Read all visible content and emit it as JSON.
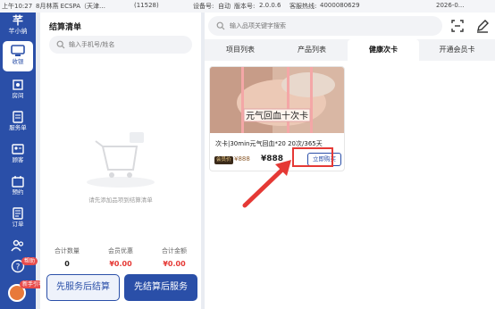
{
  "status_bar": {
    "time": "上午10:27",
    "shop": "8月林燕 ECSPA（天津…",
    "shop_id": "(11528)",
    "device_label": "设备号:",
    "device_value": "自动",
    "version_label": "版本号:",
    "version_value": "2.0.0.6",
    "phone_label": "客服热线:",
    "phone_value": "4000080629",
    "date": "2026-0..."
  },
  "sidebar": {
    "brand": "芊小纳",
    "items": [
      {
        "label": "收银",
        "icon": "monitor-icon"
      },
      {
        "label": "房间",
        "icon": "room-icon"
      },
      {
        "label": "服务单",
        "icon": "service-order-icon"
      },
      {
        "label": "顾客",
        "icon": "customer-icon"
      },
      {
        "label": "预约",
        "icon": "calendar-icon"
      },
      {
        "label": "订单",
        "icon": "order-icon"
      },
      {
        "label": "",
        "icon": "people-icon"
      }
    ],
    "help_tag": "帮助",
    "guide_tag": "新手引导"
  },
  "left_panel": {
    "title": "结算清单",
    "search_placeholder": "输入手机号/姓名",
    "empty_text": "请先添加品项到结算清单",
    "totals": [
      {
        "label": "合计数量",
        "value": "0"
      },
      {
        "label": "会员优惠",
        "value": "¥0.00"
      },
      {
        "label": "合计金额",
        "value": "¥0.00"
      }
    ],
    "btn_service_first": "先服务后结算",
    "btn_settle_first": "先结算后服务"
  },
  "right_panel": {
    "search_placeholder": "输入品项关键字搜索",
    "tabs": [
      {
        "label": "项目列表",
        "active": false
      },
      {
        "label": "产品列表",
        "active": false
      },
      {
        "label": "健康次卡",
        "active": true
      },
      {
        "label": "开通会员卡",
        "active": false
      }
    ],
    "card": {
      "image_caption": "元气回血十次卡",
      "name": "次卡|30min元气回血*20 20次/365天",
      "member_tag": "会员价",
      "member_price": "¥888",
      "price": "¥888",
      "buy_label": "立即购买"
    }
  },
  "colors": {
    "brand_blue": "#2a4fa8",
    "highlight_red": "#e53935"
  }
}
